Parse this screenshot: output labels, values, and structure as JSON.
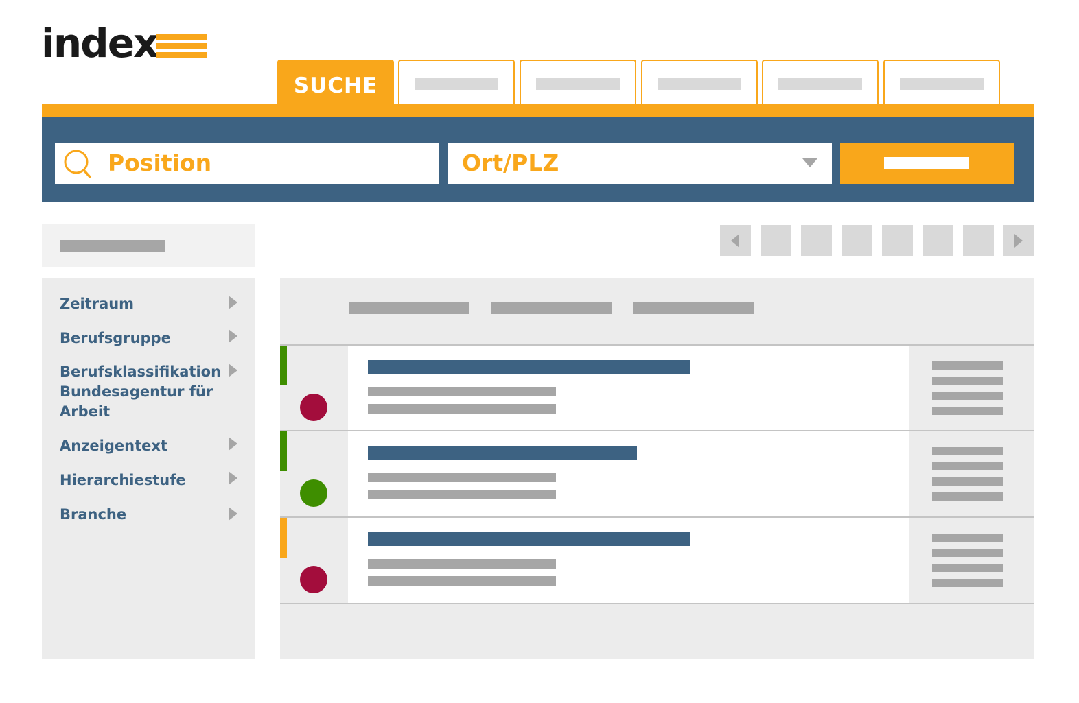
{
  "logo": {
    "text": "index"
  },
  "tabs": [
    {
      "label": "SUCHE",
      "active": true
    },
    {
      "label": "",
      "active": false
    },
    {
      "label": "",
      "active": false
    },
    {
      "label": "",
      "active": false
    },
    {
      "label": "",
      "active": false
    },
    {
      "label": "",
      "active": false
    }
  ],
  "search": {
    "position_label": "Position",
    "location_label": "Ort/PLZ"
  },
  "filters": [
    {
      "label": "Zeitraum"
    },
    {
      "label": "Berufsgruppe"
    },
    {
      "label": "Berufsklassifikation Bundesagentur für Arbeit"
    },
    {
      "label": "Anzeigentext"
    },
    {
      "label": "Hierarchiestufe"
    },
    {
      "label": "Branche"
    }
  ],
  "results": [
    {
      "status_color": "#a30d3c",
      "stripe_color": "#3e8e00"
    },
    {
      "status_color": "#3e8e00",
      "stripe_color": "#3e8e00"
    },
    {
      "status_color": "#a30d3c",
      "stripe_color": "#f9a71b"
    }
  ],
  "colors": {
    "accent": "#f9a71b",
    "navy": "#3d6282",
    "red": "#a30d3c",
    "green": "#3e8e00"
  },
  "icons": {
    "search": "search-icon",
    "dropdown": "chevron-down-icon",
    "prev": "prev-page-icon",
    "next": "next-page-icon",
    "expand": "chevron-right-icon"
  }
}
